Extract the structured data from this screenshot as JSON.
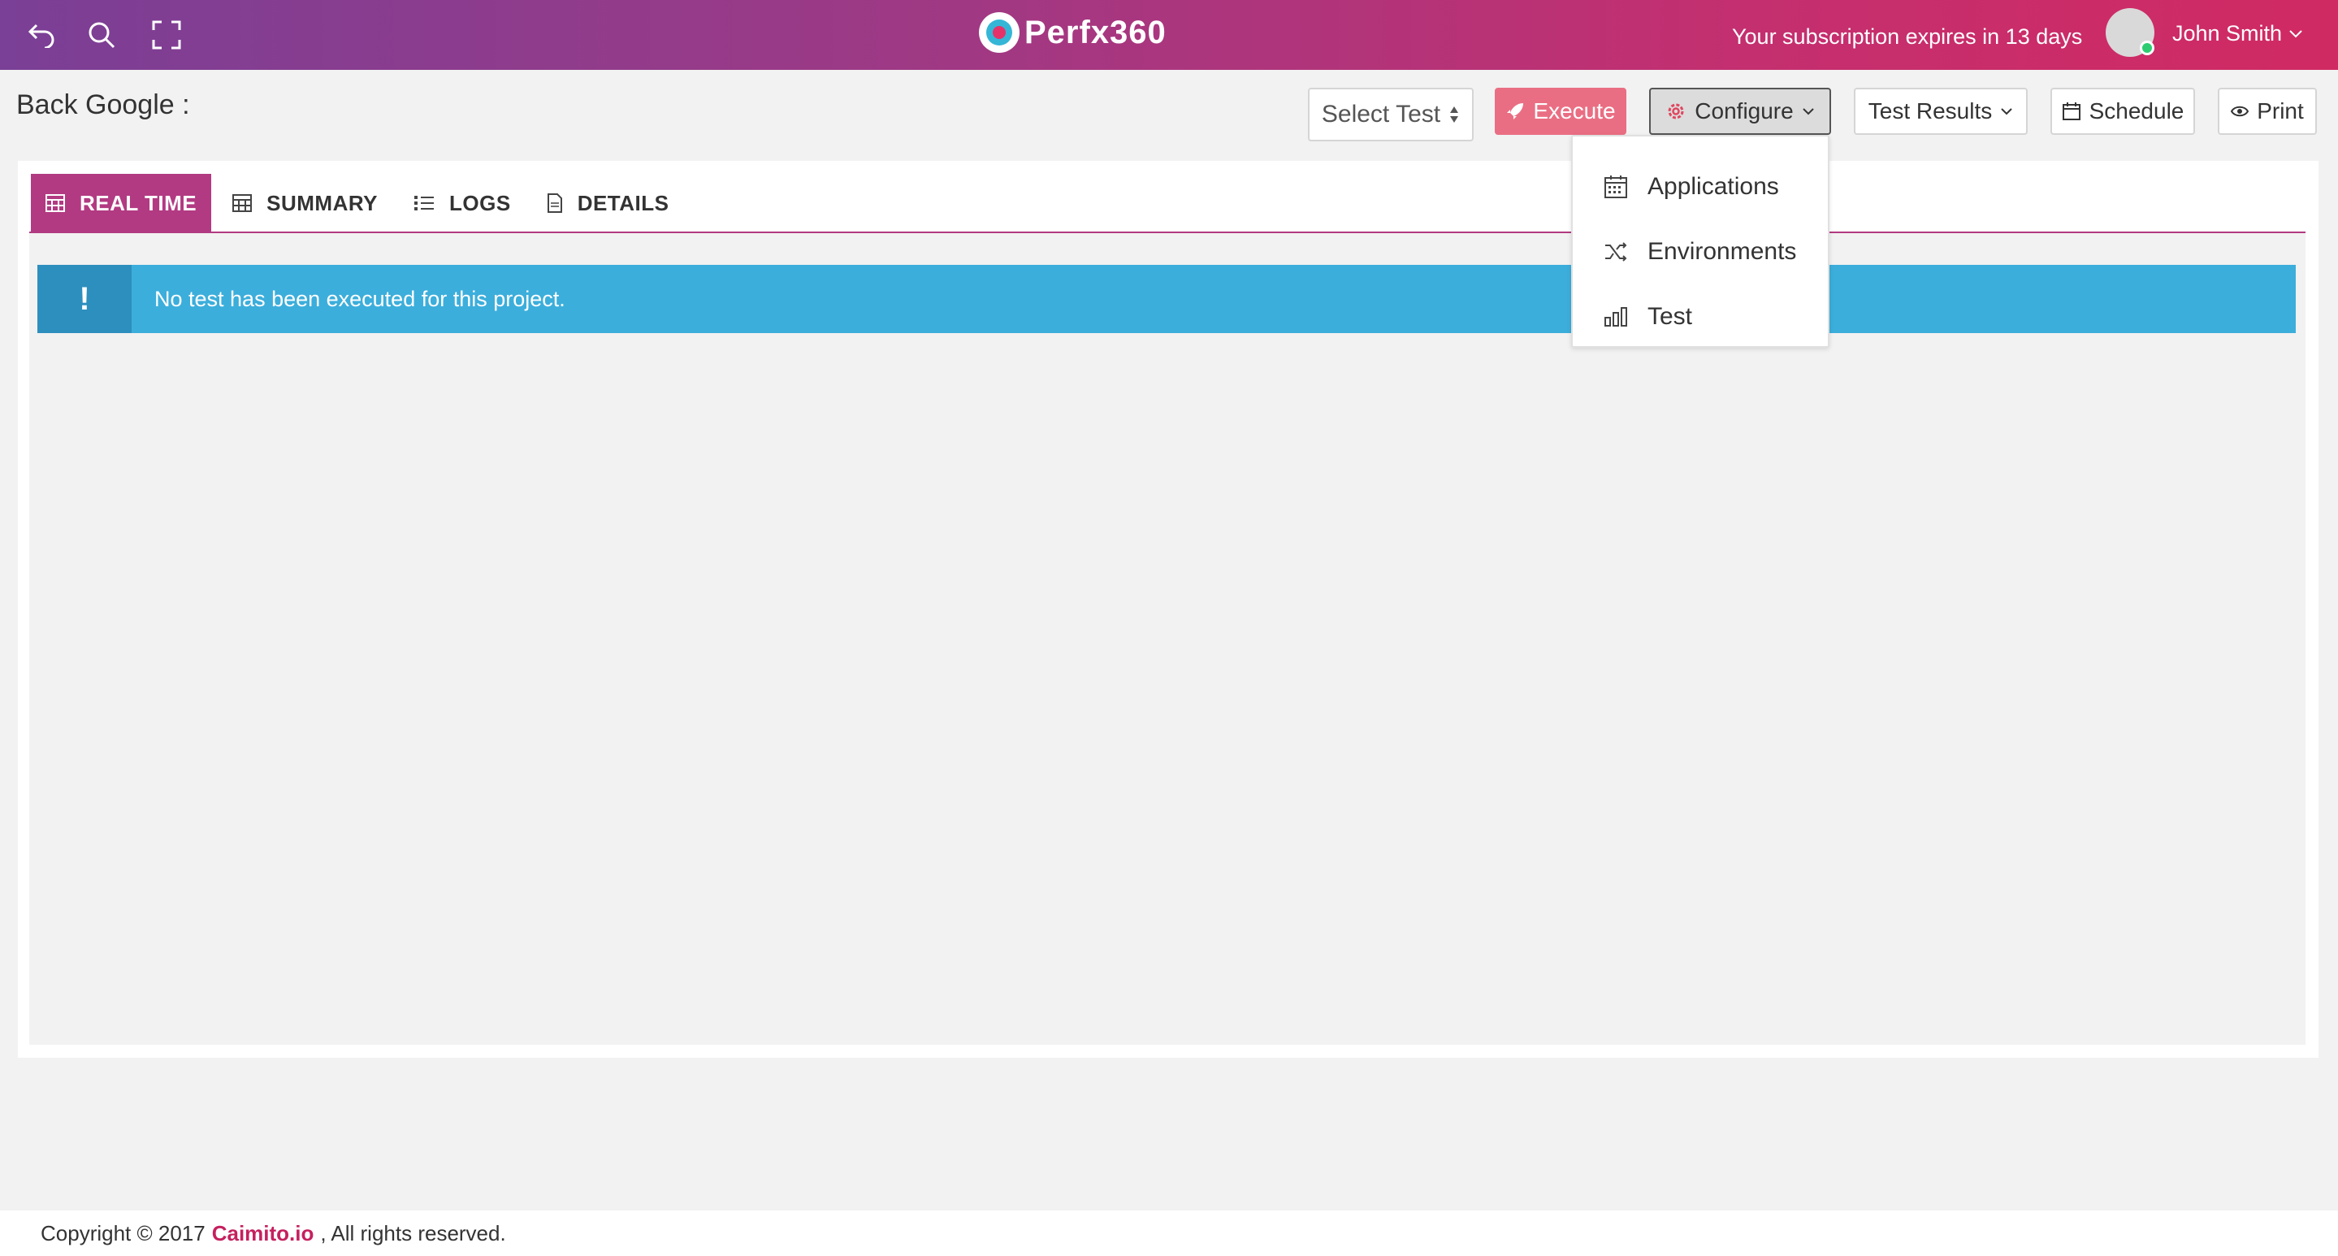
{
  "header": {
    "logo_text": "Perfx360",
    "subscription_notice": "Your subscription expires in 13 days",
    "user_name": "John Smith",
    "icons": [
      "back-arrow-icon",
      "search-icon",
      "fullscreen-icon"
    ]
  },
  "page": {
    "title": "Back Google :"
  },
  "toolbar": {
    "select_test": "Select Test",
    "execute": "Execute",
    "configure": "Configure",
    "test_results": "Test Results",
    "schedule": "Schedule",
    "print": "Print"
  },
  "configure_menu": {
    "items": [
      {
        "label": "Applications",
        "icon": "calendar-icon"
      },
      {
        "label": "Environments",
        "icon": "shuffle-icon"
      },
      {
        "label": "Test",
        "icon": "bar-chart-icon"
      }
    ]
  },
  "tabs": [
    {
      "label": "REAL TIME",
      "icon": "table-icon",
      "active": true
    },
    {
      "label": "SUMMARY",
      "icon": "table-icon",
      "active": false
    },
    {
      "label": "LOGS",
      "icon": "list-icon",
      "active": false
    },
    {
      "label": "DETAILS",
      "icon": "document-icon",
      "active": false
    }
  ],
  "alert": {
    "icon_glyph": "!",
    "message": "No test has been executed for this project."
  },
  "footer": {
    "prefix": "Copyright © 2017",
    "brand": "Caimito.io",
    "suffix": ", All rights reserved."
  },
  "colors": {
    "header_gradient_start": "#7a3f96",
    "header_gradient_end": "#d02a63",
    "accent": "#b23a82",
    "execute": "#ea6e83",
    "alert": "#3caedb",
    "brand_link": "#c5205f"
  }
}
